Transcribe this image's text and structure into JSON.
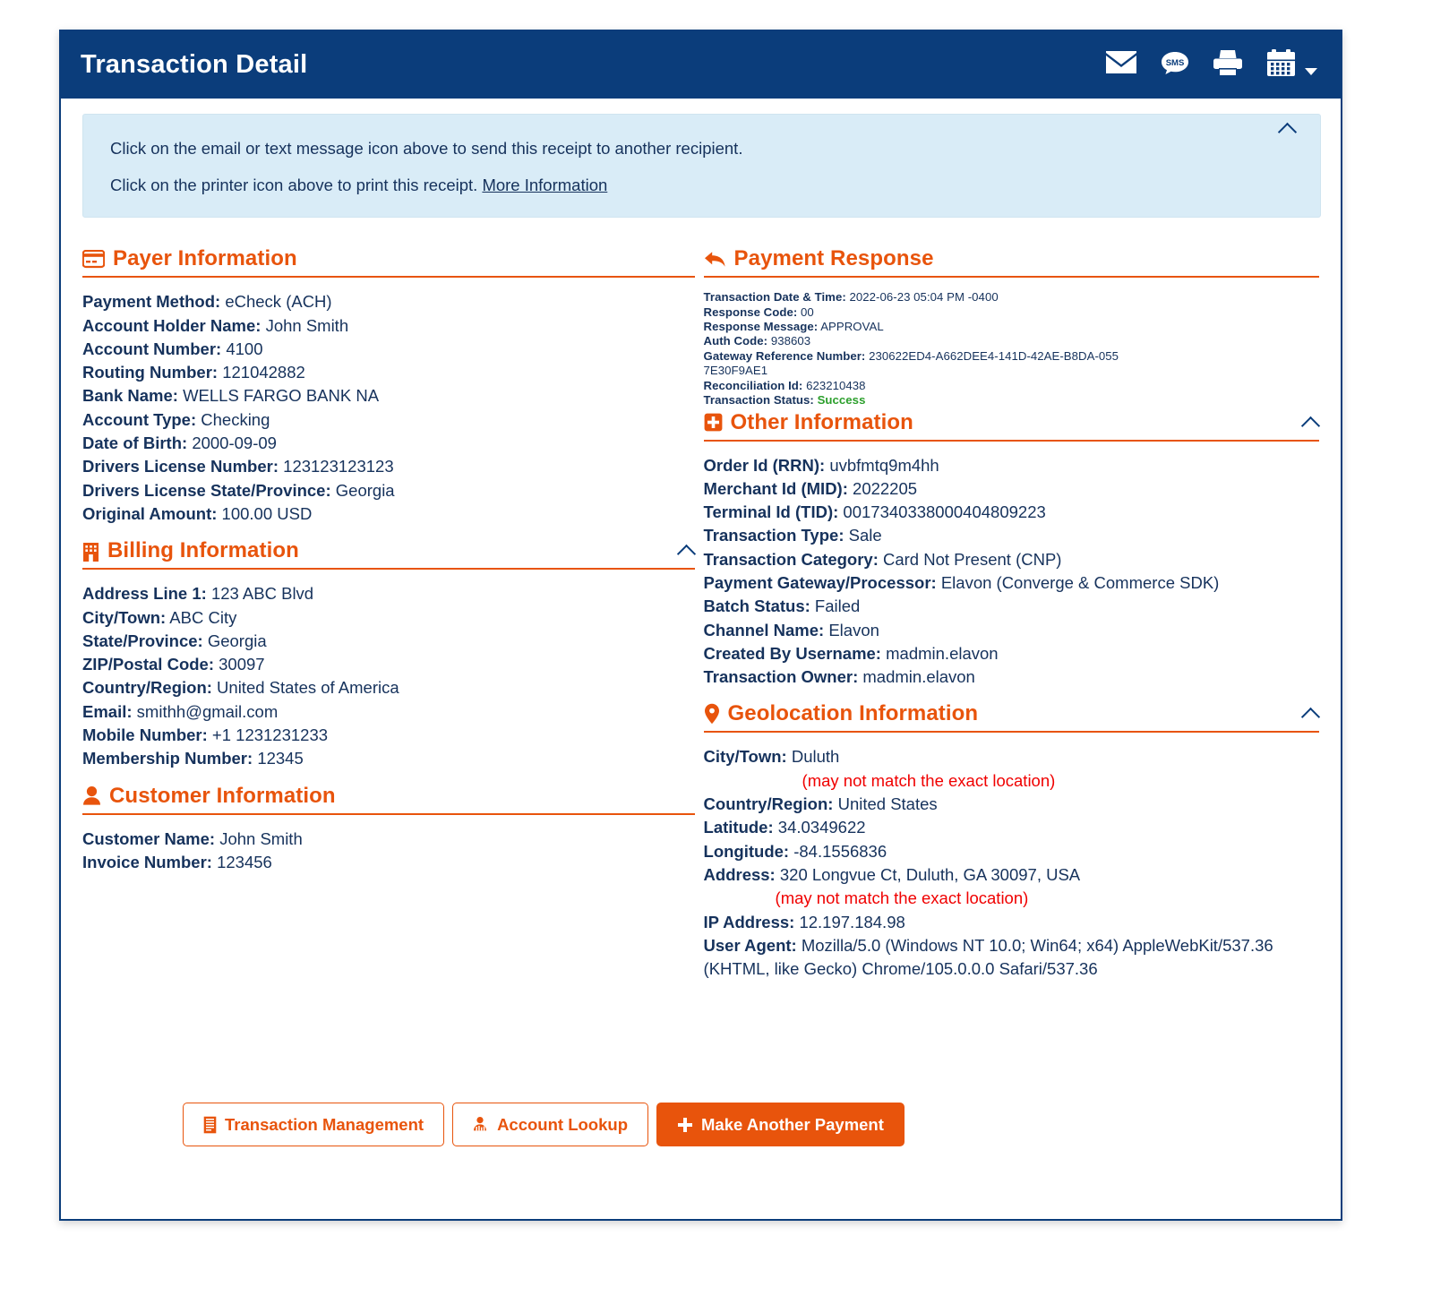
{
  "header": {
    "title": "Transaction Detail",
    "icons": [
      {
        "name": "email-icon",
        "label": "Email"
      },
      {
        "name": "sms-icon",
        "label": "SMS"
      },
      {
        "name": "printer-icon",
        "label": "Print"
      },
      {
        "name": "calendar-icon",
        "label": "Calendar"
      }
    ]
  },
  "banner": {
    "line1": "Click on the email or text message icon above to send this receipt to another recipient.",
    "line2_prefix": "Click on the printer icon above to print this receipt.",
    "link": "More Information"
  },
  "payer": {
    "heading": "Payer Information",
    "fields": [
      {
        "label": "Payment Method:",
        "value": "eCheck (ACH)"
      },
      {
        "label": "Account Holder Name:",
        "value": "John Smith"
      },
      {
        "label": "Account Number:",
        "value": "4100"
      },
      {
        "label": "Routing Number:",
        "value": "121042882"
      },
      {
        "label": "Bank Name:",
        "value": "WELLS FARGO BANK NA"
      },
      {
        "label": "Account Type:",
        "value": "Checking"
      },
      {
        "label": "Date of Birth:",
        "value": "2000-09-09"
      },
      {
        "label": "Drivers License Number:",
        "value": "123123123123"
      },
      {
        "label": "Drivers License State/Province:",
        "value": "Georgia"
      },
      {
        "label": "Original Amount:",
        "value": "100.00 USD"
      }
    ]
  },
  "billing": {
    "heading": "Billing Information",
    "fields": [
      {
        "label": "Address Line 1:",
        "value": "123 ABC Blvd"
      },
      {
        "label": "City/Town:",
        "value": "ABC City"
      },
      {
        "label": "State/Province:",
        "value": "Georgia"
      },
      {
        "label": "ZIP/Postal Code:",
        "value": "30097"
      },
      {
        "label": "Country/Region:",
        "value": "United States of America"
      },
      {
        "label": "Email:",
        "value": "smithh@gmail.com"
      },
      {
        "label": "Mobile Number:",
        "value": "+1 1231231233"
      },
      {
        "label": "Membership Number:",
        "value": "12345"
      }
    ]
  },
  "customer": {
    "heading": "Customer Information",
    "fields": [
      {
        "label": "Customer Name:",
        "value": "John Smith"
      },
      {
        "label": "Invoice Number:",
        "value": "123456"
      }
    ]
  },
  "payment_response": {
    "heading": "Payment Response",
    "fields": [
      {
        "label": "Transaction Date & Time:",
        "value": "2022-06-23 05:04 PM -0400"
      },
      {
        "label": "Response Code:",
        "value": "00"
      },
      {
        "label": "Response Message:",
        "value": "APPROVAL"
      },
      {
        "label": "Auth Code:",
        "value": "938603"
      },
      {
        "label": "Gateway Reference Number:",
        "value": "230622ED4-A662DEE4-141D-42AE-B8DA-0557E30F9AE1"
      },
      {
        "label": "Reconciliation Id:",
        "value": "623210438"
      }
    ],
    "status_label": "Transaction Status:",
    "status_value": "Success"
  },
  "other": {
    "heading": "Other Information",
    "fields": [
      {
        "label": "Order Id (RRN):",
        "value": "uvbfmtq9m4hh"
      },
      {
        "label": "Merchant Id (MID):",
        "value": "2022205"
      },
      {
        "label": "Terminal Id (TID):",
        "value": "0017340338000404809223"
      },
      {
        "label": "Transaction Type:",
        "value": "Sale"
      },
      {
        "label": "Transaction Category:",
        "value": "Card Not Present (CNP)"
      },
      {
        "label": "Payment Gateway/Processor:",
        "value": "Elavon (Converge & Commerce SDK)"
      },
      {
        "label": "Batch Status:",
        "value": "Failed"
      },
      {
        "label": "Channel Name:",
        "value": "Elavon"
      },
      {
        "label": "Created By Username:",
        "value": "madmin.elavon"
      },
      {
        "label": "Transaction Owner:",
        "value": "madmin.elavon"
      }
    ]
  },
  "geolocation": {
    "heading": "Geolocation Information",
    "city_label": "City/Town:",
    "city_value": "Duluth",
    "city_note": "(may not match the exact location)",
    "country_label": "Country/Region:",
    "country_value": "United States",
    "latitude_label": "Latitude:",
    "latitude_value": "34.0349622",
    "longitude_label": "Longitude:",
    "longitude_value": "-84.1556836",
    "address_label": "Address:",
    "address_value": "320 Longvue Ct, Duluth, GA 30097, USA",
    "address_note": "(may not match the exact location)",
    "ip_label": "IP Address:",
    "ip_value": "12.197.184.98",
    "ua_label": "User Agent:",
    "ua_value": "Mozilla/5.0 (Windows NT 10.0; Win64; x64) AppleWebKit/537.36 (KHTML, like Gecko) Chrome/105.0.0.0 Safari/537.36"
  },
  "buttons": {
    "transaction_management": "Transaction Management",
    "account_lookup": "Account Lookup",
    "make_another_payment": "Make Another Payment"
  },
  "colors": {
    "navy": "#0b3d7b",
    "orange": "#e8540c",
    "banner_bg": "#d9ecf7",
    "text_navy": "#16325c",
    "success_green": "#2c9f2c",
    "warning_red": "#f00000"
  }
}
